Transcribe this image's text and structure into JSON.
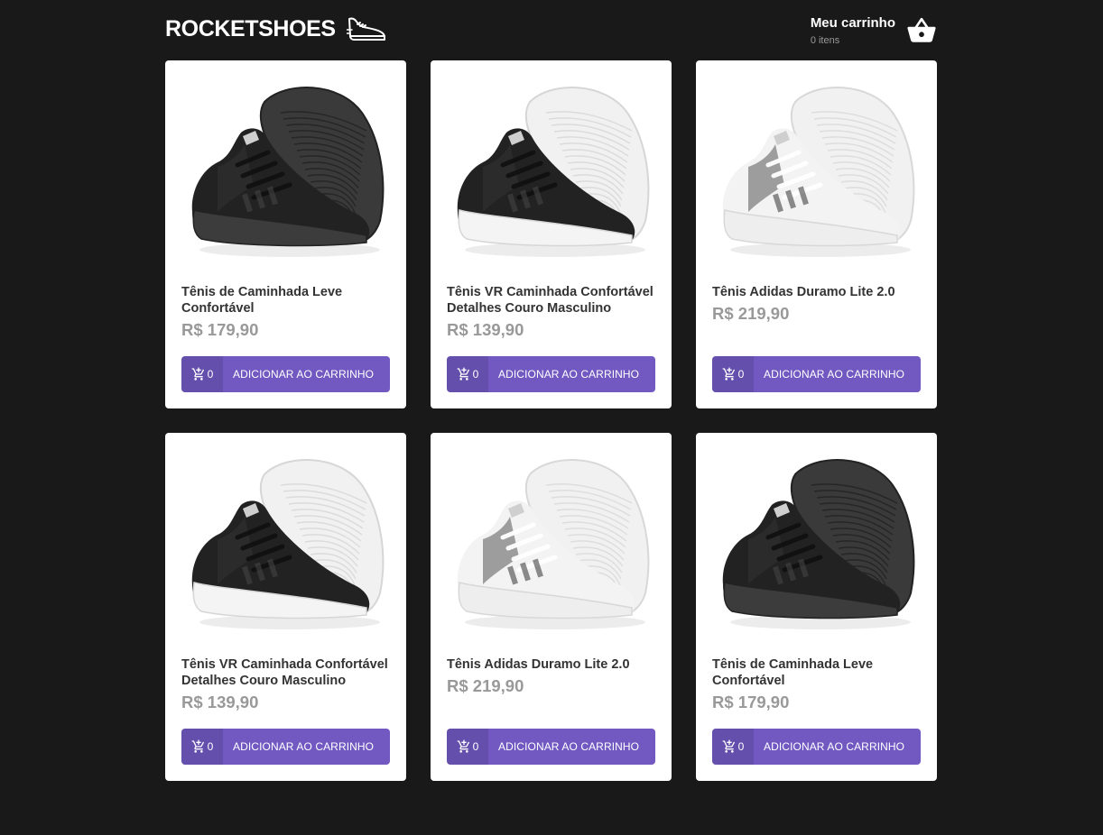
{
  "header": {
    "logo_text": "ROCKETSHOES",
    "cart_title": "Meu carrinho",
    "cart_count": "0 itens"
  },
  "products": [
    {
      "title": "Tênis de Caminhada Leve Confortável",
      "price": "R$ 179,90",
      "amount": "0",
      "button": "ADICIONAR AO CARRINHO",
      "variant": "black"
    },
    {
      "title": "Tênis VR Caminhada Confortável Detalhes Couro Masculino",
      "price": "R$ 139,90",
      "amount": "0",
      "button": "ADICIONAR AO CARRINHO",
      "variant": "black-white"
    },
    {
      "title": "Tênis Adidas Duramo Lite 2.0",
      "price": "R$ 219,90",
      "amount": "0",
      "button": "ADICIONAR AO CARRINHO",
      "variant": "white"
    },
    {
      "title": "Tênis VR Caminhada Confortável Detalhes Couro Masculino",
      "price": "R$ 139,90",
      "amount": "0",
      "button": "ADICIONAR AO CARRINHO",
      "variant": "black-white"
    },
    {
      "title": "Tênis Adidas Duramo Lite 2.0",
      "price": "R$ 219,90",
      "amount": "0",
      "button": "ADICIONAR AO CARRINHO",
      "variant": "white"
    },
    {
      "title": "Tênis de Caminhada Leve Confortável",
      "price": "R$ 179,90",
      "amount": "0",
      "button": "ADICIONAR AO CARRINHO",
      "variant": "black"
    }
  ],
  "colors": {
    "background": "#191919",
    "accent": "#7159c1",
    "price": "#999999"
  },
  "icons": {
    "logo": "running-shoe-icon",
    "cart": "shopping-basket-icon",
    "add": "add-shopping-cart-icon"
  }
}
